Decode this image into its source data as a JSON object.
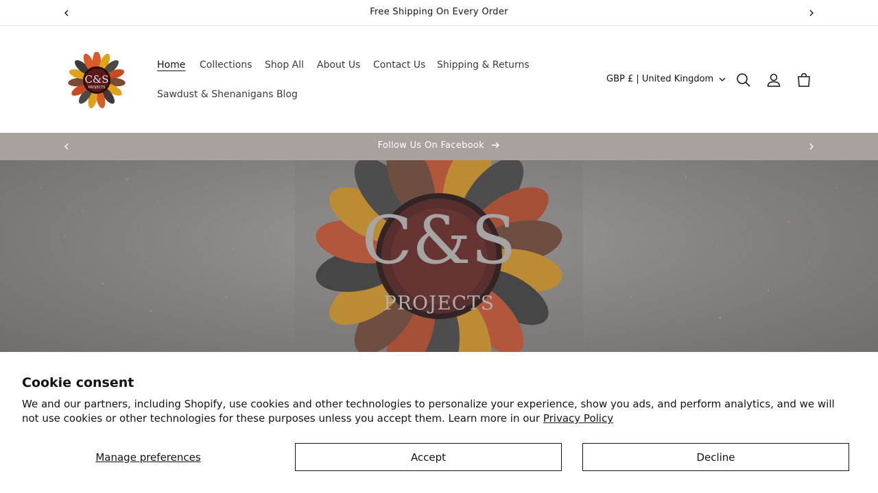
{
  "announcement": {
    "text": "Free Shipping On Every Order"
  },
  "nav": {
    "items": [
      {
        "label": "Home",
        "active": true
      },
      {
        "label": "Collections"
      },
      {
        "label": "Shop All"
      },
      {
        "label": "About Us"
      },
      {
        "label": "Contact Us"
      },
      {
        "label": "Shipping & Returns"
      },
      {
        "label": "Sawdust & Shenanigans Blog"
      }
    ]
  },
  "header": {
    "locale": "GBP £ | United Kingdom",
    "icons": [
      "search-icon",
      "account-icon",
      "cart-icon"
    ]
  },
  "promo_bar": {
    "text": "Follow Us On Facebook"
  },
  "hero": {
    "brand_main": "C&S",
    "brand_sub": "PROJECTS"
  },
  "cookie": {
    "title": "Cookie consent",
    "body": "We and our partners, including Shopify, use cookies and other technologies to personalize your experience, show you ads, and perform analytics, and we will not use cookies or other technologies for these purposes unless you accept them. Learn more in our ",
    "policy_link": "Privacy Policy",
    "manage": "Manage preferences",
    "accept": "Accept",
    "decline": "Decline"
  },
  "colors": {
    "promo_bar": "#a9a19d",
    "text": "#121212",
    "accent_orange": "#d95a2b",
    "accent_yellow": "#e0a11b"
  }
}
